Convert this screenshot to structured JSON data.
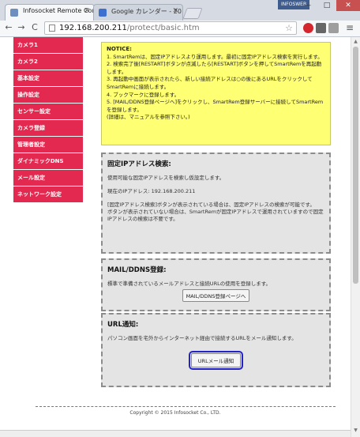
{
  "browser": {
    "tabs": [
      {
        "label": "Infosocket Remote Cor",
        "active": true
      },
      {
        "label": "Google カレンダー - 20",
        "active": false
      }
    ],
    "user_badge": "INFOSWEB",
    "window_controls": {
      "minimize": "—",
      "maximize": "□",
      "close": "✕"
    },
    "nav": {
      "back": "←",
      "forward": "→",
      "reload": "C"
    },
    "address": {
      "host": "192.168.200.211",
      "path": "/protect/basic.htm"
    }
  },
  "sidebar": {
    "items": [
      {
        "label": "カメラ1"
      },
      {
        "label": "カメラ2"
      },
      {
        "label": "基本設定"
      },
      {
        "label": "操作設定"
      },
      {
        "label": "センサー設定"
      },
      {
        "label": "カメラ登録"
      },
      {
        "label": "管理者設定"
      },
      {
        "label": "ダイナミックDNS"
      },
      {
        "label": "メール設定"
      },
      {
        "label": "ネットワーク設定"
      }
    ]
  },
  "notice": {
    "title": "NOTICE:",
    "lines": [
      "1. SmartRemは、固定IPアドレスより運用します。最初に固定IPアドレス検索を実行します。",
      "2. 検索完了後[RESTART]ボタンが点滅したら[RESTART]ボタンを押してSmartRemを再起動します。",
      "3. 再起動中画面が表示されたら、新しい接続アドレスは○の後にあるURLをクリックしてSmartRemに接続します。",
      "4. ブックマークに登録します。",
      "5. [MAIL/DDNS登録ページへ]をクリックし、SmartRem登録サーバーに接続してSmartRemを登録します。",
      "(詳細は、マニュアルを参照下さい。)"
    ]
  },
  "ip_search": {
    "title": "固定IPアドレス検索:",
    "text1": "使用可能な固定IPアドレスを検索し仮設定します。",
    "text2": "現在のIPアドレス: 192.168.200.211",
    "text3": "[固定IPアドレス検索]ボタンが表示されている場合は、固定IPアドレスの検索が可能です。",
    "text4": "ボタンが表示されていない場合は、SmartRemが固定IPアドレスで運用されていますので固定IPアドレスの検索は不要です。"
  },
  "mail_ddns": {
    "title": "MAIL/DDNS登録:",
    "text": "標準で準備されているメールアドレスと接続URLの使用を登録します。",
    "button": "MAIL/DDNS登録ページへ"
  },
  "url_notify": {
    "title": "URL通知:",
    "text": "パソコン画面を宅外からインターネット経由で接続するURLをメール通知します。",
    "button": "URLメール通知"
  },
  "footer": {
    "copyright": "Copyright © 2015 Infosocket Co., LTD."
  },
  "colors": {
    "sidebar": "#e3294f",
    "notice_bg": "#ffff73",
    "box_bg": "#e4e4e4",
    "focus": "#2323c8"
  }
}
